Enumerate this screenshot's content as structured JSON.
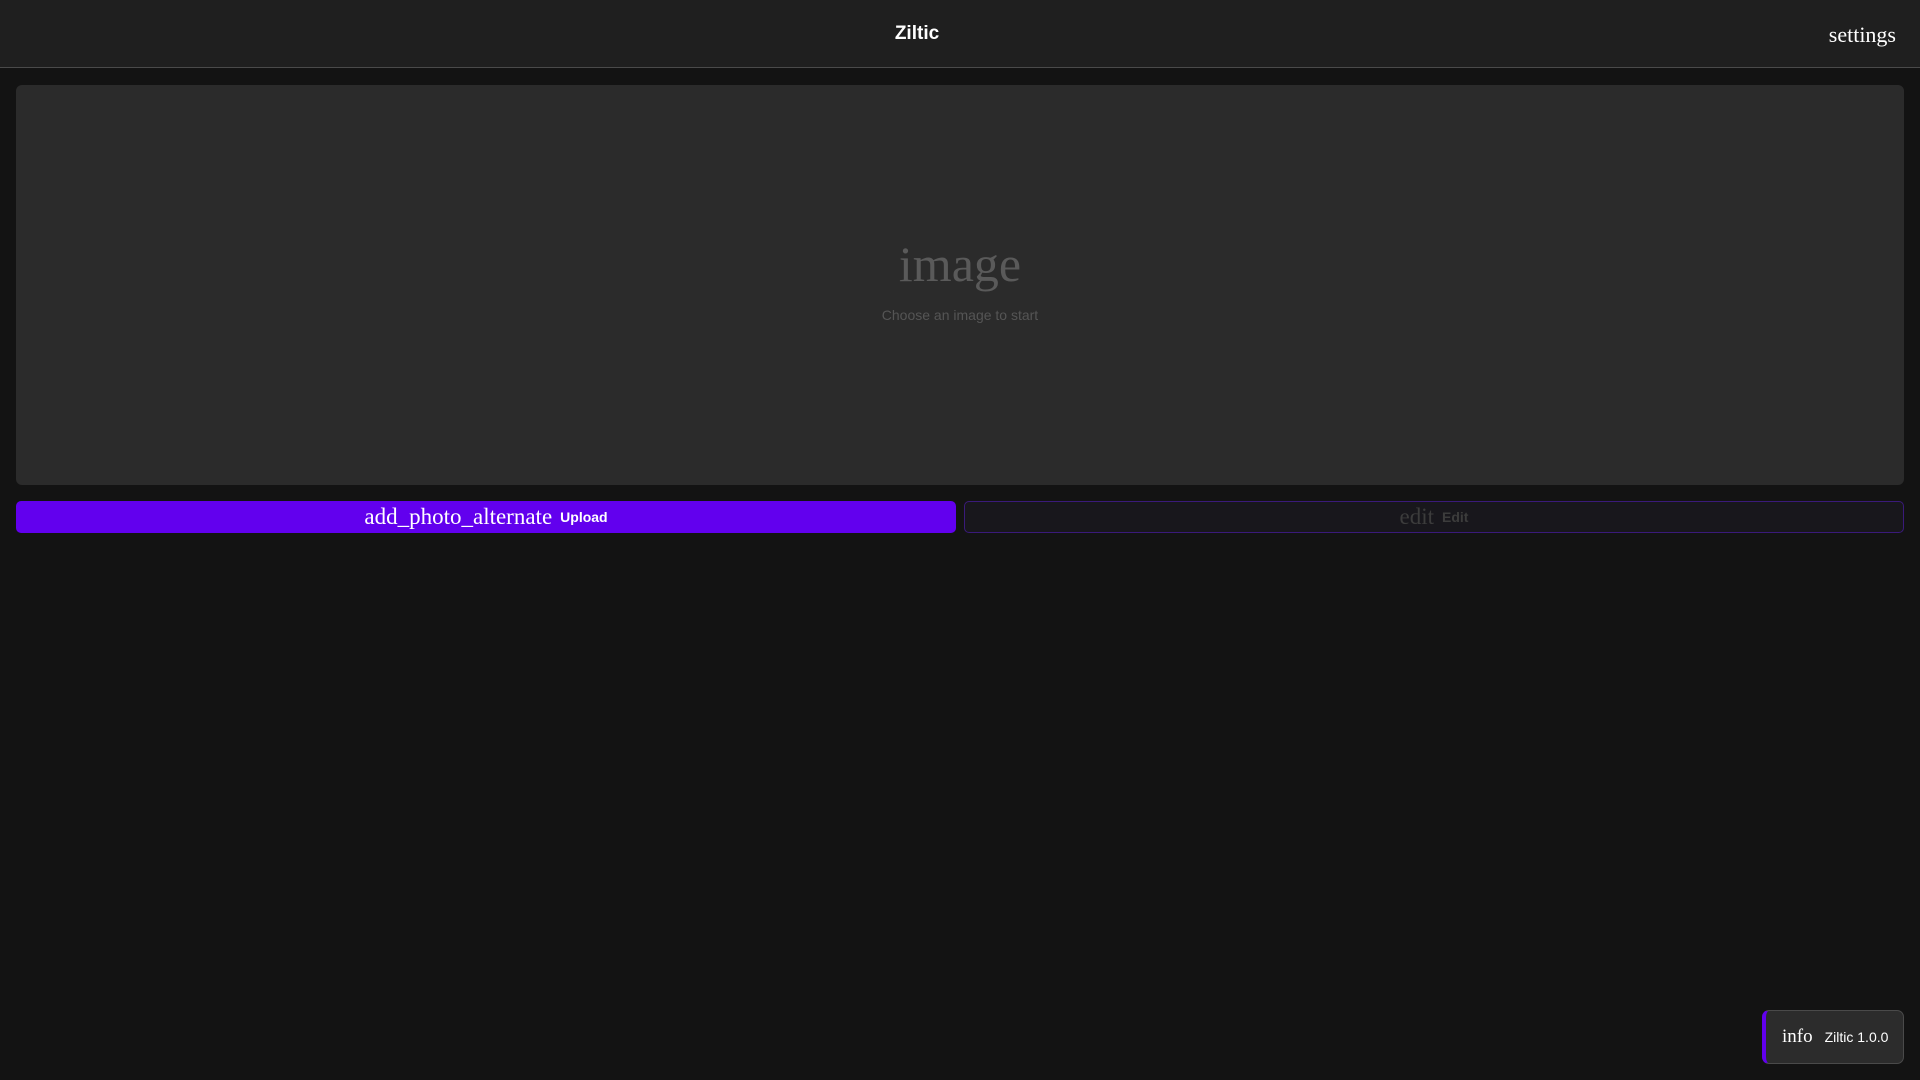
{
  "header": {
    "title": "Ziltic",
    "settings_icon": "settings"
  },
  "preview": {
    "icon": "image",
    "placeholder": "Choose an image to start"
  },
  "actions": {
    "upload": {
      "icon": "add_photo_alternate",
      "label": "Upload",
      "enabled": true
    },
    "edit": {
      "icon": "edit",
      "label": "Edit",
      "enabled": false
    }
  },
  "toast": {
    "icon": "info",
    "text": "Ziltic 1.0.0"
  },
  "colors": {
    "accent": "#6200ee",
    "background": "#131313",
    "topbar": "#1f1f1f",
    "panel": "#2b2b2b"
  }
}
